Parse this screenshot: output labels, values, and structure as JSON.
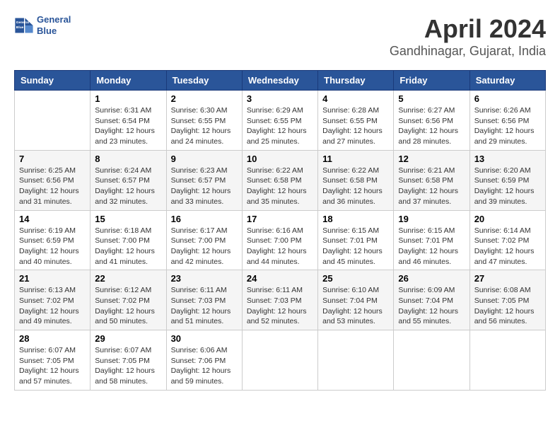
{
  "header": {
    "logo_line1": "General",
    "logo_line2": "Blue",
    "title": "April 2024",
    "subtitle": "Gandhinagar, Gujarat, India"
  },
  "calendar": {
    "days_of_week": [
      "Sunday",
      "Monday",
      "Tuesday",
      "Wednesday",
      "Thursday",
      "Friday",
      "Saturday"
    ],
    "weeks": [
      [
        {
          "day": "",
          "info": ""
        },
        {
          "day": "1",
          "info": "Sunrise: 6:31 AM\nSunset: 6:54 PM\nDaylight: 12 hours\nand 23 minutes."
        },
        {
          "day": "2",
          "info": "Sunrise: 6:30 AM\nSunset: 6:55 PM\nDaylight: 12 hours\nand 24 minutes."
        },
        {
          "day": "3",
          "info": "Sunrise: 6:29 AM\nSunset: 6:55 PM\nDaylight: 12 hours\nand 25 minutes."
        },
        {
          "day": "4",
          "info": "Sunrise: 6:28 AM\nSunset: 6:55 PM\nDaylight: 12 hours\nand 27 minutes."
        },
        {
          "day": "5",
          "info": "Sunrise: 6:27 AM\nSunset: 6:56 PM\nDaylight: 12 hours\nand 28 minutes."
        },
        {
          "day": "6",
          "info": "Sunrise: 6:26 AM\nSunset: 6:56 PM\nDaylight: 12 hours\nand 29 minutes."
        }
      ],
      [
        {
          "day": "7",
          "info": "Sunrise: 6:25 AM\nSunset: 6:56 PM\nDaylight: 12 hours\nand 31 minutes."
        },
        {
          "day": "8",
          "info": "Sunrise: 6:24 AM\nSunset: 6:57 PM\nDaylight: 12 hours\nand 32 minutes."
        },
        {
          "day": "9",
          "info": "Sunrise: 6:23 AM\nSunset: 6:57 PM\nDaylight: 12 hours\nand 33 minutes."
        },
        {
          "day": "10",
          "info": "Sunrise: 6:22 AM\nSunset: 6:58 PM\nDaylight: 12 hours\nand 35 minutes."
        },
        {
          "day": "11",
          "info": "Sunrise: 6:22 AM\nSunset: 6:58 PM\nDaylight: 12 hours\nand 36 minutes."
        },
        {
          "day": "12",
          "info": "Sunrise: 6:21 AM\nSunset: 6:58 PM\nDaylight: 12 hours\nand 37 minutes."
        },
        {
          "day": "13",
          "info": "Sunrise: 6:20 AM\nSunset: 6:59 PM\nDaylight: 12 hours\nand 39 minutes."
        }
      ],
      [
        {
          "day": "14",
          "info": "Sunrise: 6:19 AM\nSunset: 6:59 PM\nDaylight: 12 hours\nand 40 minutes."
        },
        {
          "day": "15",
          "info": "Sunrise: 6:18 AM\nSunset: 7:00 PM\nDaylight: 12 hours\nand 41 minutes."
        },
        {
          "day": "16",
          "info": "Sunrise: 6:17 AM\nSunset: 7:00 PM\nDaylight: 12 hours\nand 42 minutes."
        },
        {
          "day": "17",
          "info": "Sunrise: 6:16 AM\nSunset: 7:00 PM\nDaylight: 12 hours\nand 44 minutes."
        },
        {
          "day": "18",
          "info": "Sunrise: 6:15 AM\nSunset: 7:01 PM\nDaylight: 12 hours\nand 45 minutes."
        },
        {
          "day": "19",
          "info": "Sunrise: 6:15 AM\nSunset: 7:01 PM\nDaylight: 12 hours\nand 46 minutes."
        },
        {
          "day": "20",
          "info": "Sunrise: 6:14 AM\nSunset: 7:02 PM\nDaylight: 12 hours\nand 47 minutes."
        }
      ],
      [
        {
          "day": "21",
          "info": "Sunrise: 6:13 AM\nSunset: 7:02 PM\nDaylight: 12 hours\nand 49 minutes."
        },
        {
          "day": "22",
          "info": "Sunrise: 6:12 AM\nSunset: 7:02 PM\nDaylight: 12 hours\nand 50 minutes."
        },
        {
          "day": "23",
          "info": "Sunrise: 6:11 AM\nSunset: 7:03 PM\nDaylight: 12 hours\nand 51 minutes."
        },
        {
          "day": "24",
          "info": "Sunrise: 6:11 AM\nSunset: 7:03 PM\nDaylight: 12 hours\nand 52 minutes."
        },
        {
          "day": "25",
          "info": "Sunrise: 6:10 AM\nSunset: 7:04 PM\nDaylight: 12 hours\nand 53 minutes."
        },
        {
          "day": "26",
          "info": "Sunrise: 6:09 AM\nSunset: 7:04 PM\nDaylight: 12 hours\nand 55 minutes."
        },
        {
          "day": "27",
          "info": "Sunrise: 6:08 AM\nSunset: 7:05 PM\nDaylight: 12 hours\nand 56 minutes."
        }
      ],
      [
        {
          "day": "28",
          "info": "Sunrise: 6:07 AM\nSunset: 7:05 PM\nDaylight: 12 hours\nand 57 minutes."
        },
        {
          "day": "29",
          "info": "Sunrise: 6:07 AM\nSunset: 7:05 PM\nDaylight: 12 hours\nand 58 minutes."
        },
        {
          "day": "30",
          "info": "Sunrise: 6:06 AM\nSunset: 7:06 PM\nDaylight: 12 hours\nand 59 minutes."
        },
        {
          "day": "",
          "info": ""
        },
        {
          "day": "",
          "info": ""
        },
        {
          "day": "",
          "info": ""
        },
        {
          "day": "",
          "info": ""
        }
      ]
    ]
  }
}
